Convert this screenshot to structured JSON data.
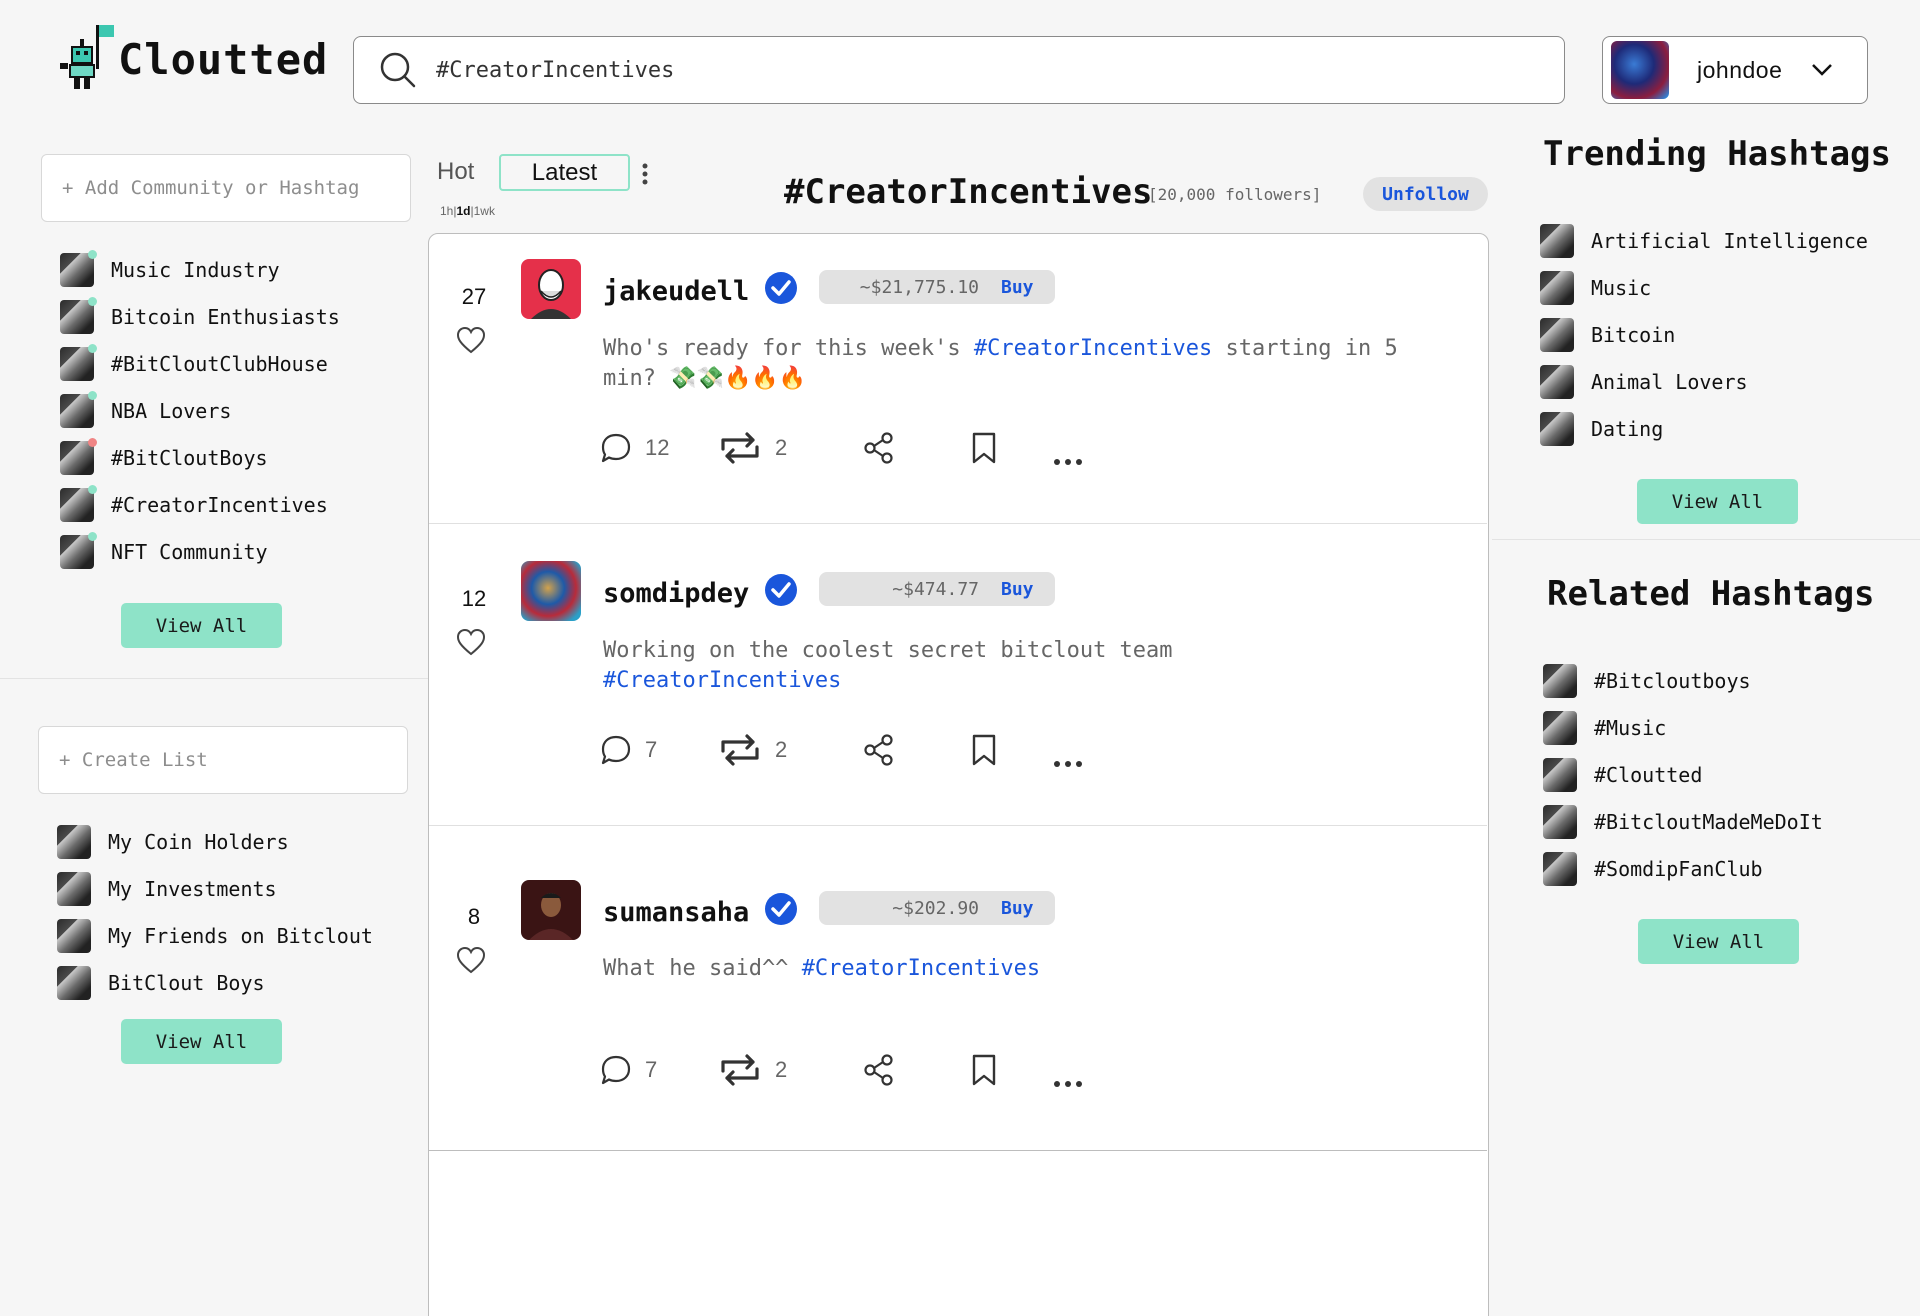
{
  "brand": {
    "name": "Cloutted"
  },
  "search": {
    "value": "#CreatorIncentives",
    "placeholder": "Search"
  },
  "user": {
    "username": "johndoe"
  },
  "sidebar": {
    "add_community_placeholder": "+ Add Community or Hashtag",
    "communities": [
      {
        "label": "Music Industry",
        "status": "green"
      },
      {
        "label": "Bitcoin Enthusiasts",
        "status": "green"
      },
      {
        "label": "#BitCloutClubHouse",
        "status": "green"
      },
      {
        "label": "NBA Lovers",
        "status": "green"
      },
      {
        "label": "#BitCloutBoys",
        "status": "red"
      },
      {
        "label": "#CreatorIncentives",
        "status": "green"
      },
      {
        "label": "NFT Community",
        "status": "green"
      }
    ],
    "communities_view_all": "View All",
    "create_list_placeholder": "+ Create List",
    "lists": [
      {
        "label": "My Coin Holders"
      },
      {
        "label": "My Investments"
      },
      {
        "label": "My Friends on Bitclout"
      },
      {
        "label": "BitClout Boys"
      }
    ],
    "lists_view_all": "View All"
  },
  "feed_header": {
    "tabs": [
      {
        "label": "Hot"
      },
      {
        "label": "Latest"
      }
    ],
    "time_filters": [
      "1h",
      "1d",
      "1wk"
    ],
    "hashtag": "#CreatorIncentives",
    "followers": "[20,000 followers]",
    "unfollow_label": "Unfollow"
  },
  "posts": [
    {
      "likes": "27",
      "username": "jakeudell",
      "price": "~$21,775.10",
      "buy_label": "Buy",
      "text_before": "Who's ready for this week's ",
      "hashtag": "#CreatorIncentives",
      "text_after": " starting in 5 min? 💸💸🔥🔥🔥",
      "comments": "12",
      "reclouts": "2"
    },
    {
      "likes": "12",
      "username": "somdipdey",
      "price": "~$474.77",
      "buy_label": "Buy",
      "text_before": "Working on the coolest secret bitclout team ",
      "hashtag": "#CreatorIncentives",
      "text_after": "",
      "comments": "7",
      "reclouts": "2"
    },
    {
      "likes": "8",
      "username": "sumansaha",
      "price": "~$202.90",
      "buy_label": "Buy",
      "text_before": "What he said^^ ",
      "hashtag": "#CreatorIncentives",
      "text_after": "",
      "comments": "7",
      "reclouts": "2"
    }
  ],
  "trending": {
    "title": "Trending Hashtags",
    "items": [
      {
        "label": "Artificial Intelligence"
      },
      {
        "label": "Music"
      },
      {
        "label": "Bitcoin"
      },
      {
        "label": "Animal Lovers"
      },
      {
        "label": "Dating"
      }
    ],
    "view_all": "View All"
  },
  "related": {
    "title": "Related Hashtags",
    "items": [
      {
        "label": "#Bitcloutboys"
      },
      {
        "label": "#Music"
      },
      {
        "label": "#Cloutted"
      },
      {
        "label": "#BitcloutMadeMeDoIt"
      },
      {
        "label": "#SomdipFanClub"
      }
    ],
    "view_all": "View All"
  },
  "colors": {
    "accent": "#8ee3c8",
    "link": "#1a56db",
    "online": "#8ee3c8",
    "offline": "#f08585"
  }
}
